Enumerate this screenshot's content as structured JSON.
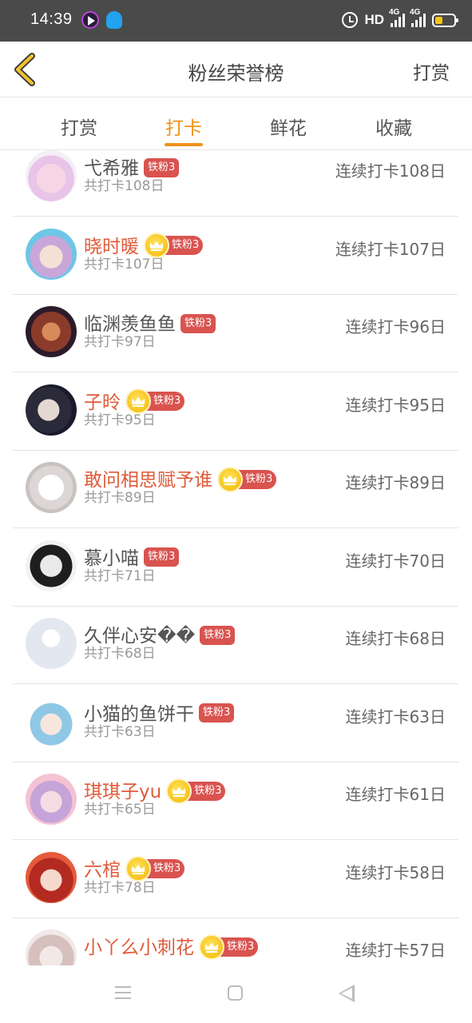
{
  "status_bar": {
    "time": "14:39",
    "network_label": "HD",
    "signal_1": "4G",
    "signal_2": "4G",
    "battery_color": "#f5c518"
  },
  "header": {
    "title": "粉丝荣誉榜",
    "action_label": "打赏",
    "back_icon": "chevron-left-icon"
  },
  "tabs": [
    {
      "label": "打赏",
      "active": false
    },
    {
      "label": "打卡",
      "active": true
    },
    {
      "label": "鲜花",
      "active": false
    },
    {
      "label": "收藏",
      "active": false
    }
  ],
  "colors": {
    "accent": "#f0921a",
    "highlight_name": "#e05b3a",
    "fan_badge": "#d9534f",
    "crown": "#f4b400"
  },
  "rows": [
    {
      "name": "弋希雅",
      "badge": "铁粉3",
      "crown": false,
      "vip": false,
      "total": "共打卡108日",
      "streak": "连续打卡108日"
    },
    {
      "name": "晓时暖",
      "badge": "铁粉3",
      "crown": true,
      "vip": true,
      "total": "共打卡107日",
      "streak": "连续打卡107日"
    },
    {
      "name": "临渊羡鱼鱼",
      "badge": "铁粉3",
      "crown": false,
      "vip": false,
      "total": "共打卡97日",
      "streak": "连续打卡96日"
    },
    {
      "name": "子昤",
      "badge": "铁粉3",
      "crown": true,
      "vip": true,
      "total": "共打卡95日",
      "streak": "连续打卡95日"
    },
    {
      "name": "敢问相思赋予谁",
      "badge": "铁粉3",
      "crown": true,
      "vip": true,
      "total": "共打卡89日",
      "streak": "连续打卡89日"
    },
    {
      "name": "慕小喵",
      "badge": "铁粉3",
      "crown": false,
      "vip": false,
      "total": "共打卡71日",
      "streak": "连续打卡70日"
    },
    {
      "name": "久伴心安��",
      "badge": "铁粉3",
      "crown": false,
      "vip": false,
      "total": "共打卡68日",
      "streak": "连续打卡68日"
    },
    {
      "name": "小猫的鱼饼干",
      "badge": "铁粉3",
      "crown": false,
      "vip": false,
      "total": "共打卡63日",
      "streak": "连续打卡63日"
    },
    {
      "name": "琪琪子yu",
      "badge": "铁粉3",
      "crown": true,
      "vip": true,
      "total": "共打卡65日",
      "streak": "连续打卡61日"
    },
    {
      "name": "六棺",
      "badge": "铁粉3",
      "crown": true,
      "vip": true,
      "total": "共打卡78日",
      "streak": "连续打卡58日"
    },
    {
      "name": "小丫么小刺花",
      "badge": "铁粉3",
      "crown": true,
      "vip": true,
      "total": "",
      "streak": "连续打卡57日"
    }
  ],
  "nav_icons": [
    "menu-icon",
    "home-icon",
    "back-icon"
  ]
}
